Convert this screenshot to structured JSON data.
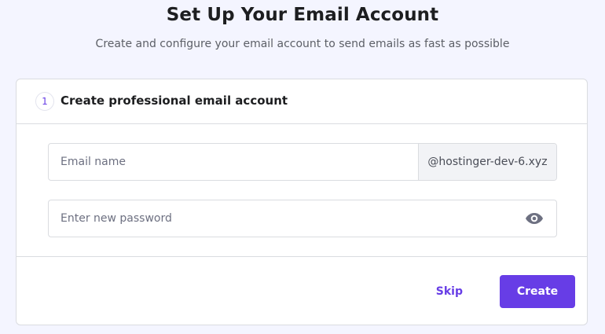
{
  "header": {
    "title": "Set Up Your Email Account",
    "subtitle": "Create and configure your email account to send emails as fast as possible"
  },
  "step": {
    "number": "1",
    "title": "Create professional email account"
  },
  "form": {
    "email_name": {
      "placeholder": "Email name",
      "value": "",
      "domain_suffix": "@hostinger-dev-6.xyz"
    },
    "password": {
      "placeholder": "Enter new password",
      "value": "",
      "toggle_icon": "eye-icon"
    }
  },
  "actions": {
    "skip_label": "Skip",
    "create_label": "Create"
  },
  "colors": {
    "accent": "#673de6",
    "page_background": "#f4f5ff",
    "border": "#dadce0",
    "domain_background": "#f2f3f6"
  }
}
